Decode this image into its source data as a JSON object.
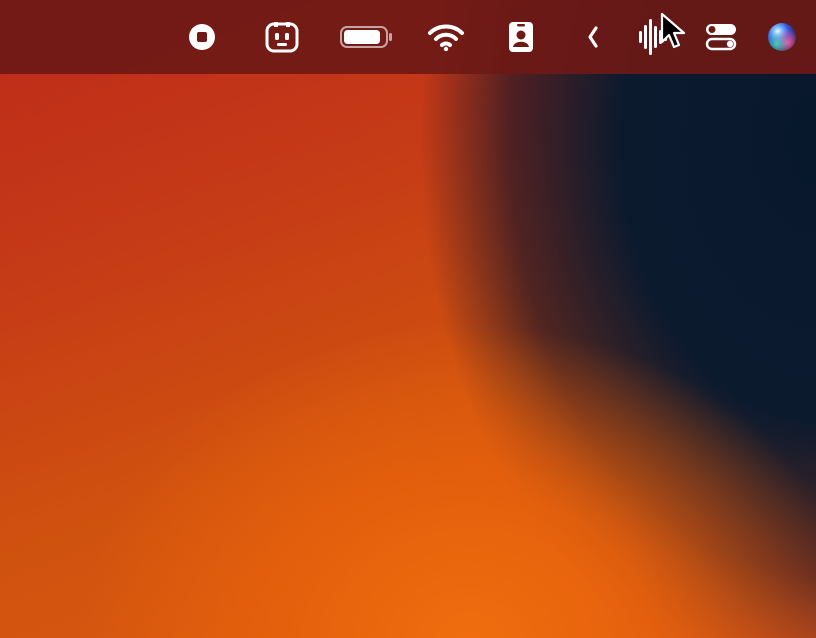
{
  "menubar": {
    "items": [
      {
        "icon": "record-stop-icon",
        "role": "screen-recording"
      },
      {
        "icon": "bot-face-icon",
        "role": "menu-extra"
      },
      {
        "icon": "battery-icon",
        "role": "battery",
        "level_fraction": 0.9
      },
      {
        "icon": "wifi-icon",
        "role": "wifi"
      },
      {
        "icon": "contact-card-icon",
        "role": "menu-extra"
      },
      {
        "icon": "chevron-left-icon",
        "role": "collapse-menu-extras"
      },
      {
        "icon": "audio-waveform-icon",
        "role": "voice-control"
      },
      {
        "icon": "control-center-icon",
        "role": "control-center"
      },
      {
        "icon": "siri-icon",
        "role": "siri"
      }
    ]
  },
  "colors": {
    "menubar_bg": "#6e1916",
    "wallpaper_red": "#c23a1a",
    "wallpaper_orange": "#f06d0e",
    "wallpaper_navy": "#0c1a2e",
    "icon": "#ffffff"
  },
  "pointer": {
    "icon": "arrow-cursor-icon"
  }
}
